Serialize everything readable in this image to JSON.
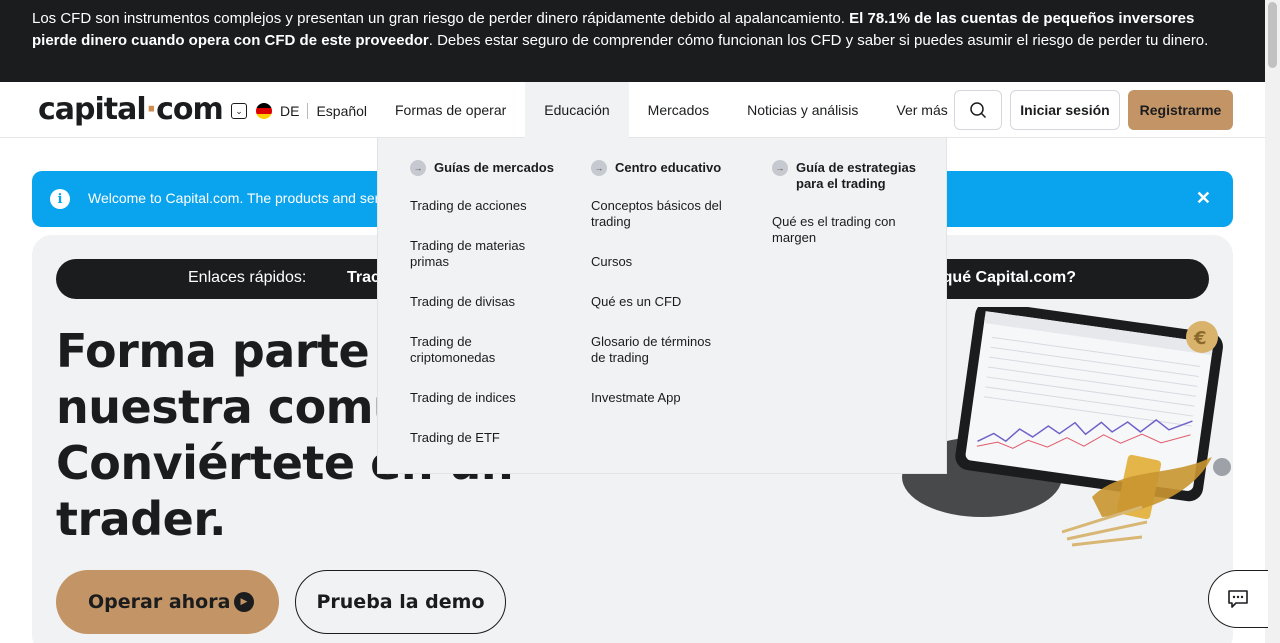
{
  "risk_banner": {
    "text_before": "Los CFD son instrumentos complejos y presentan un gran riesgo de perder dinero rápidamente debido al apalancamiento. ",
    "text_bold": "El 78.1% de las cuentas de pequeños inversores pierde dinero cuando opera con CFD de este proveedor",
    "text_after": ". Debes estar seguro de comprender cómo funcionan los CFD y saber si puedes asumir el riesgo de perder tu dinero."
  },
  "header": {
    "logo_main": "capital",
    "logo_dot": "·",
    "logo_tail": "com",
    "country_code": "DE",
    "language": "Español",
    "nav": [
      "Formas de operar",
      "Educación",
      "Mercados",
      "Noticias y análisis",
      "Ver más"
    ],
    "login_label": "Iniciar sesión",
    "register_label": "Registrarme"
  },
  "welcome": {
    "text": "Welcome to Capital.com. The products and servi",
    "close": "✕"
  },
  "hero": {
    "quick_links_label": "Enlaces rápidos:",
    "quick_link_first": "Trac",
    "quick_link_last": "qué Capital.com?",
    "title": "Forma parte d nuestra comur Conviértete en un trader.",
    "title_lines": [
      "Forma parte d",
      "nuestra comur",
      "Conviértete en un",
      "trader."
    ],
    "cta_primary": "Operar ahora",
    "cta_secondary": "Prueba la demo"
  },
  "mega_menu": {
    "columns": [
      {
        "heading": "Guías de mercados",
        "items": [
          "Trading de acciones",
          "Trading de materias primas",
          "Trading de divisas",
          "Trading de criptomonedas",
          "Trading de indices",
          "Trading de ETF"
        ]
      },
      {
        "heading": "Centro educativo",
        "items": [
          "Conceptos básicos del trading",
          "Cursos",
          "Qué es un CFD",
          "Glosario de términos de trading",
          "Investmate App"
        ]
      },
      {
        "heading": "Guía de estrategias para el trading",
        "items": [
          "Qué es el trading con margen"
        ]
      }
    ]
  },
  "colors": {
    "brand_accent": "#c39566",
    "dark": "#1b1c1e",
    "info_blue": "#0aa4ee"
  }
}
